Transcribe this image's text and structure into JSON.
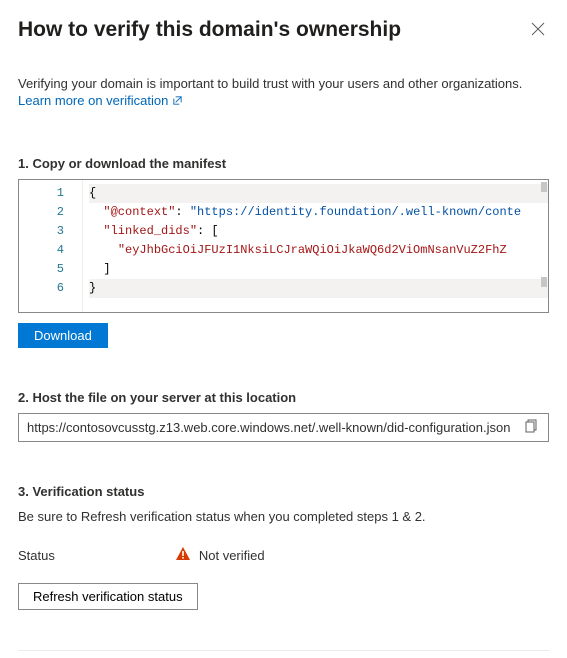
{
  "header": {
    "title": "How to verify this domain's ownership"
  },
  "intro": {
    "text": "Verifying your domain is important to build trust with your users and other organizations.",
    "link": "Learn more on verification"
  },
  "step1": {
    "title": "1. Copy or download the manifest",
    "lines": [
      "1",
      "2",
      "3",
      "4",
      "5",
      "6"
    ],
    "code": {
      "l1_brace": "{",
      "l2_key": "\"@context\"",
      "l2_colon": ": ",
      "l2_val": "\"https://identity.foundation/.well-known/conte",
      "l3_key": "\"linked_dids\"",
      "l3_colon": ": [",
      "l4_val": "\"eyJhbGciOiJFUzI1NksiLCJraWQiOiJkaWQ6d2ViOmNsanVuZ2FhZ",
      "l5_bracket": "]",
      "l6_brace": "}"
    },
    "download": "Download"
  },
  "step2": {
    "title": "2. Host the file on your server at this location",
    "url": "https://contosovcusstg.z13.web.core.windows.net/.well-known/did-configuration.json"
  },
  "step3": {
    "title": "3. Verification status",
    "desc": "Be sure to Refresh verification status when you completed steps 1 & 2.",
    "status_label": "Status",
    "status_value": "Not verified",
    "refresh": "Refresh verification status"
  }
}
